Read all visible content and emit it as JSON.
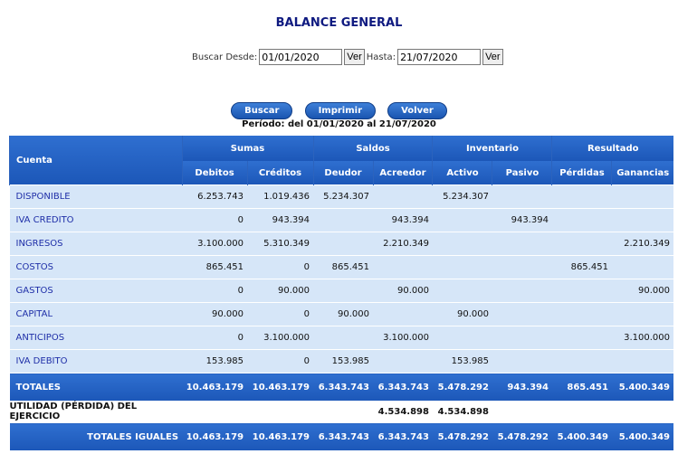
{
  "page": {
    "title": "BALANCE GENERAL",
    "search": {
      "desde_label": "Buscar Desde:",
      "desde_value": "01/01/2020",
      "ver_label": "Ver",
      "hasta_label": "Hasta:",
      "hasta_value": "21/07/2020"
    },
    "buttons": {
      "buscar": "Buscar",
      "imprimir": "Imprimir",
      "volver": "Volver"
    },
    "period": "Período: del 01/01/2020 al 21/07/2020"
  },
  "table": {
    "groups": {
      "cuenta": "Cuenta",
      "sumas": "Sumas",
      "saldos": "Saldos",
      "inventario": "Inventario",
      "resultado": "Resultado"
    },
    "columns": [
      "Debitos",
      "Créditos",
      "Deudor",
      "Acreedor",
      "Activo",
      "Pasivo",
      "Pérdidas",
      "Ganancias"
    ],
    "rows": [
      {
        "cuenta": "DISPONIBLE",
        "values": [
          "6.253.743",
          "1.019.436",
          "5.234.307",
          "",
          "5.234.307",
          "",
          "",
          ""
        ]
      },
      {
        "cuenta": "IVA CREDITO",
        "values": [
          "0",
          "943.394",
          "",
          "943.394",
          "",
          "943.394",
          "",
          ""
        ]
      },
      {
        "cuenta": "INGRESOS",
        "values": [
          "3.100.000",
          "5.310.349",
          "",
          "2.210.349",
          "",
          "",
          "",
          "2.210.349"
        ]
      },
      {
        "cuenta": "COSTOS",
        "values": [
          "865.451",
          "0",
          "865.451",
          "",
          "",
          "",
          "865.451",
          ""
        ]
      },
      {
        "cuenta": "GASTOS",
        "values": [
          "0",
          "90.000",
          "",
          "90.000",
          "",
          "",
          "",
          "90.000"
        ]
      },
      {
        "cuenta": "CAPITAL",
        "values": [
          "90.000",
          "0",
          "90.000",
          "",
          "90.000",
          "",
          "",
          ""
        ]
      },
      {
        "cuenta": "ANTICIPOS",
        "values": [
          "0",
          "3.100.000",
          "",
          "3.100.000",
          "",
          "",
          "",
          "3.100.000"
        ]
      },
      {
        "cuenta": "IVA DEBITO",
        "values": [
          "153.985",
          "0",
          "153.985",
          "",
          "153.985",
          "",
          "",
          ""
        ]
      }
    ],
    "totales": {
      "label": "TOTALES",
      "values": [
        "10.463.179",
        "10.463.179",
        "6.343.743",
        "6.343.743",
        "5.478.292",
        "943.394",
        "865.451",
        "5.400.349"
      ]
    },
    "utilidad": {
      "label": "UTILIDAD (PÉRDIDA) DEL EJERCICIO",
      "values": [
        "",
        "",
        "",
        "4.534.898",
        "4.534.898",
        "",
        "",
        ""
      ]
    },
    "totales_iguales": {
      "label": "TOTALES IGUALES",
      "values": [
        "10.463.179",
        "10.463.179",
        "6.343.743",
        "6.343.743",
        "5.478.292",
        "5.478.292",
        "5.400.349",
        "5.400.349"
      ]
    }
  }
}
